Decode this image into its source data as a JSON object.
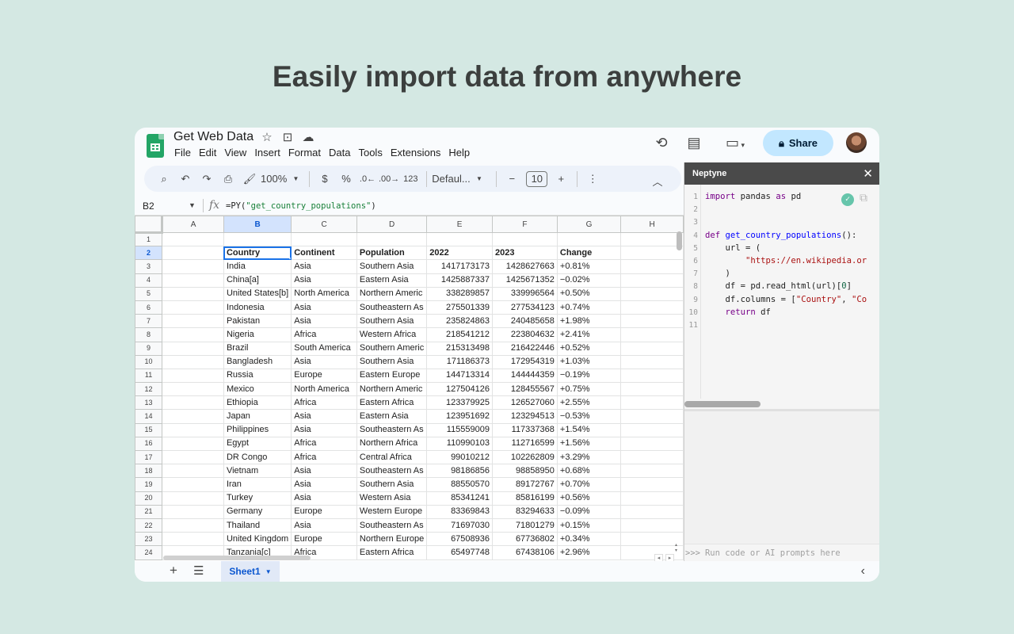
{
  "headline": "Easily import data from anywhere",
  "doc": {
    "title": "Get Web Data",
    "menus": [
      "File",
      "Edit",
      "View",
      "Insert",
      "Format",
      "Data",
      "Tools",
      "Extensions",
      "Help"
    ],
    "share_label": "Share"
  },
  "toolbar": {
    "zoom": "100%",
    "currency": "$",
    "percent": "%",
    "dec_decrease": ".0←",
    "dec_increase": ".00→",
    "number_format": "123",
    "font": "Defaul...",
    "font_size": "10"
  },
  "formula_bar": {
    "cell_ref": "B2",
    "formula_prefix": "=PY(",
    "formula_arg": "\"get_country_populations\"",
    "formula_suffix": ")"
  },
  "sheet": {
    "columns": [
      "A",
      "B",
      "C",
      "D",
      "E",
      "F",
      "G",
      "H"
    ],
    "rows": [
      [
        "1",
        "",
        "",
        "",
        "",
        "",
        "",
        "",
        ""
      ],
      [
        "2",
        "",
        "Country",
        "Continent",
        "Population",
        "2022",
        "2023",
        "Change",
        ""
      ],
      [
        "3",
        "",
        "India",
        "Asia",
        "Southern Asia",
        "1417173173",
        "1428627663",
        "+0.81%",
        ""
      ],
      [
        "4",
        "",
        "China[a]",
        "Asia",
        "Eastern Asia",
        "1425887337",
        "1425671352",
        "−0.02%",
        ""
      ],
      [
        "5",
        "",
        "United States[b]",
        "North America",
        "Northern Americ",
        "338289857",
        "339996564",
        "+0.50%",
        ""
      ],
      [
        "6",
        "",
        "Indonesia",
        "Asia",
        "Southeastern As",
        "275501339",
        "277534123",
        "+0.74%",
        ""
      ],
      [
        "7",
        "",
        "Pakistan",
        "Asia",
        "Southern Asia",
        "235824863",
        "240485658",
        "+1.98%",
        ""
      ],
      [
        "8",
        "",
        "Nigeria",
        "Africa",
        "Western Africa",
        "218541212",
        "223804632",
        "+2.41%",
        ""
      ],
      [
        "9",
        "",
        "Brazil",
        "South America",
        "Southern Americ",
        "215313498",
        "216422446",
        "+0.52%",
        ""
      ],
      [
        "10",
        "",
        "Bangladesh",
        "Asia",
        "Southern Asia",
        "171186373",
        "172954319",
        "+1.03%",
        ""
      ],
      [
        "11",
        "",
        "Russia",
        "Europe",
        "Eastern Europe",
        "144713314",
        "144444359",
        "−0.19%",
        ""
      ],
      [
        "12",
        "",
        "Mexico",
        "North America",
        "Northern Americ",
        "127504126",
        "128455567",
        "+0.75%",
        ""
      ],
      [
        "13",
        "",
        "Ethiopia",
        "Africa",
        "Eastern Africa",
        "123379925",
        "126527060",
        "+2.55%",
        ""
      ],
      [
        "14",
        "",
        "Japan",
        "Asia",
        "Eastern Asia",
        "123951692",
        "123294513",
        "−0.53%",
        ""
      ],
      [
        "15",
        "",
        "Philippines",
        "Asia",
        "Southeastern As",
        "115559009",
        "117337368",
        "+1.54%",
        ""
      ],
      [
        "16",
        "",
        "Egypt",
        "Africa",
        "Northern Africa",
        "110990103",
        "112716599",
        "+1.56%",
        ""
      ],
      [
        "17",
        "",
        "DR Congo",
        "Africa",
        "Central Africa",
        "99010212",
        "102262809",
        "+3.29%",
        ""
      ],
      [
        "18",
        "",
        "Vietnam",
        "Asia",
        "Southeastern As",
        "98186856",
        "98858950",
        "+0.68%",
        ""
      ],
      [
        "19",
        "",
        "Iran",
        "Asia",
        "Southern Asia",
        "88550570",
        "89172767",
        "+0.70%",
        ""
      ],
      [
        "20",
        "",
        "Turkey",
        "Asia",
        "Western Asia",
        "85341241",
        "85816199",
        "+0.56%",
        ""
      ],
      [
        "21",
        "",
        "Germany",
        "Europe",
        "Western Europe",
        "83369843",
        "83294633",
        "−0.09%",
        ""
      ],
      [
        "22",
        "",
        "Thailand",
        "Asia",
        "Southeastern As",
        "71697030",
        "71801279",
        "+0.15%",
        ""
      ],
      [
        "23",
        "",
        "United Kingdom",
        "Europe",
        "Northern Europe",
        "67508936",
        "67736802",
        "+0.34%",
        ""
      ],
      [
        "24",
        "",
        "Tanzania[c]",
        "Africa",
        "Eastern Africa",
        "65497748",
        "67438106",
        "+2.96%",
        ""
      ]
    ],
    "tab_label": "Sheet1"
  },
  "panel": {
    "title": "Neptyne",
    "prompt_marker": ">>>",
    "prompt_placeholder": "Run code or AI prompts here",
    "code_lines": [
      [
        {
          "t": "import",
          "c": "kw"
        },
        {
          "t": " pandas ",
          "c": ""
        },
        {
          "t": "as",
          "c": "kw"
        },
        {
          "t": " pd",
          "c": ""
        }
      ],
      [],
      [],
      [
        {
          "t": "def",
          "c": "kw"
        },
        {
          "t": " ",
          "c": ""
        },
        {
          "t": "get_country_populations",
          "c": "fn"
        },
        {
          "t": "():",
          "c": ""
        }
      ],
      [
        {
          "t": "    url = (",
          "c": ""
        }
      ],
      [
        {
          "t": "        ",
          "c": ""
        },
        {
          "t": "\"https://en.wikipedia.or",
          "c": "s"
        }
      ],
      [
        {
          "t": "    )",
          "c": ""
        }
      ],
      [
        {
          "t": "    df = pd.read_html(url)[",
          "c": ""
        },
        {
          "t": "0",
          "c": "nm"
        },
        {
          "t": "]",
          "c": ""
        }
      ],
      [
        {
          "t": "    df.columns = [",
          "c": ""
        },
        {
          "t": "\"Country\"",
          "c": "s"
        },
        {
          "t": ", ",
          "c": ""
        },
        {
          "t": "\"Co",
          "c": "s"
        }
      ],
      [
        {
          "t": "    ",
          "c": ""
        },
        {
          "t": "return",
          "c": "kw"
        },
        {
          "t": " df",
          "c": ""
        }
      ],
      []
    ]
  },
  "colors": {
    "background": "#d4e8e3",
    "share_button": "#c2e7ff",
    "selection": "#1a73e8",
    "sheets_green": "#23a566",
    "panel_header": "#4a4a4a"
  }
}
